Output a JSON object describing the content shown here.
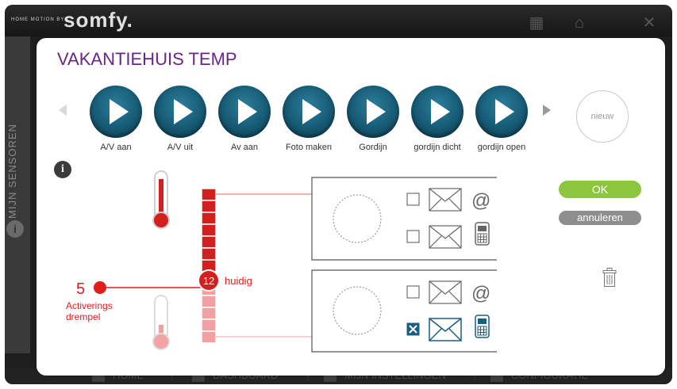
{
  "header": {
    "brand_small": "HOME MOTION BY",
    "brand_logo": "somfy."
  },
  "sidebar": {
    "label": "MIJN SENSOREN"
  },
  "bottom_nav": {
    "items": [
      {
        "label": "HOME",
        "icon": "home-icon"
      },
      {
        "label": "DASHBOARD",
        "icon": "dashboard-icon"
      },
      {
        "label": "MIJN INSTELLINGEN",
        "icon": "person-icon"
      },
      {
        "label": "CONFIGURATIE",
        "icon": "gear-icon"
      }
    ]
  },
  "dialog": {
    "title": "VAKANTIEHUIS TEMP",
    "scenes": [
      {
        "label": "A/V aan"
      },
      {
        "label": "A/V uit"
      },
      {
        "label": "Av aan"
      },
      {
        "label": "Foto maken"
      },
      {
        "label": "Gordijn"
      },
      {
        "label": "gordijn dicht"
      },
      {
        "label": "gordijn open"
      }
    ],
    "new_label": "nieuw",
    "ok_label": "OK",
    "cancel_label": "annuleren",
    "current_value": "12",
    "current_label": "huidig",
    "threshold_value": "5",
    "threshold_label_line1": "Activerings",
    "threshold_label_line2": "drempel",
    "email_symbol": "@",
    "rules": [
      {
        "email_checked": false,
        "sms_checked": false
      },
      {
        "email_checked": false,
        "sms_checked": true
      }
    ]
  },
  "colors": {
    "title": "#6a2585",
    "scene_button": "#175a74",
    "ok": "#8cc63f",
    "cancel": "#8e8e8e",
    "hot": "#e11d1d",
    "cold": "#f0a0a0",
    "checked": "#1a5f80"
  }
}
